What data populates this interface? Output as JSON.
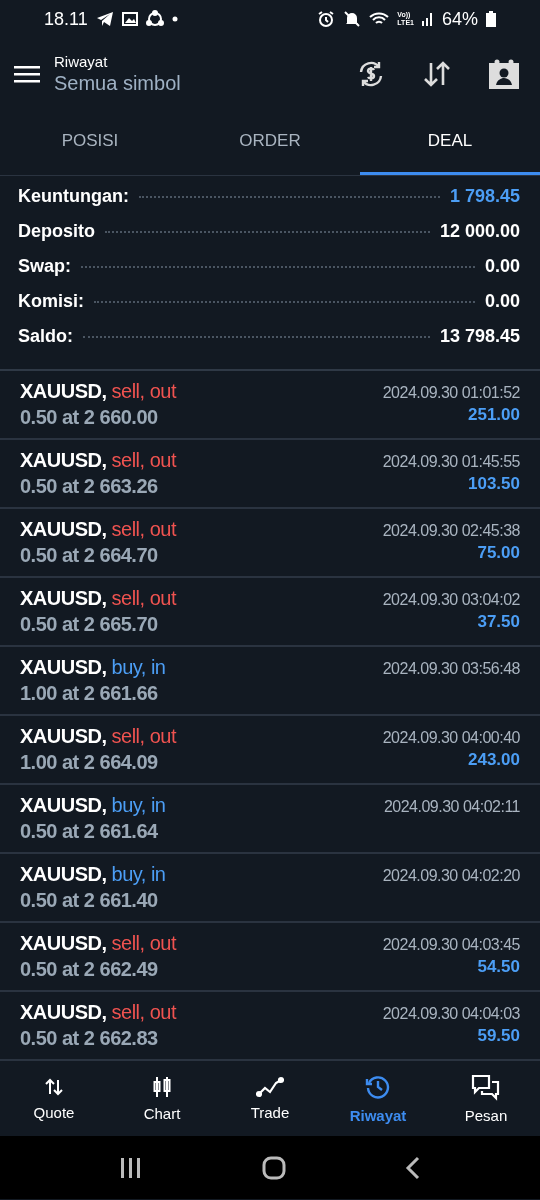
{
  "status_bar": {
    "time": "18.11",
    "network_top": "Vo))",
    "network_bottom": "LTE1",
    "battery": "64%"
  },
  "header": {
    "title": "Riwayat",
    "subtitle": "Semua simbol"
  },
  "tabs": [
    {
      "label": "POSISI",
      "selected": false
    },
    {
      "label": "ORDER",
      "selected": false
    },
    {
      "label": "DEAL",
      "selected": true
    }
  ],
  "summary": [
    {
      "label": "Keuntungan:",
      "value": "1 798.45",
      "kind": "profit"
    },
    {
      "label": "Deposito",
      "value": "12 000.00",
      "kind": "plain"
    },
    {
      "label": "Swap:",
      "value": "0.00",
      "kind": "plain"
    },
    {
      "label": "Komisi:",
      "value": "0.00",
      "kind": "plain"
    },
    {
      "label": "Saldo:",
      "value": "13 798.45",
      "kind": "plain"
    }
  ],
  "deals": [
    {
      "symbol": "XAUUSD,",
      "side": "sell, out",
      "kind": "sell",
      "volume_price": "0.50 at 2 660.00",
      "time": "2024.09.30 01:01:52",
      "profit": "251.00"
    },
    {
      "symbol": "XAUUSD,",
      "side": "sell, out",
      "kind": "sell",
      "volume_price": "0.50 at 2 663.26",
      "time": "2024.09.30 01:45:55",
      "profit": "103.50"
    },
    {
      "symbol": "XAUUSD,",
      "side": "sell, out",
      "kind": "sell",
      "volume_price": "0.50 at 2 664.70",
      "time": "2024.09.30 02:45:38",
      "profit": "75.00"
    },
    {
      "symbol": "XAUUSD,",
      "side": "sell, out",
      "kind": "sell",
      "volume_price": "0.50 at 2 665.70",
      "time": "2024.09.30 03:04:02",
      "profit": "37.50"
    },
    {
      "symbol": "XAUUSD,",
      "side": "buy, in",
      "kind": "buy",
      "volume_price": "1.00 at 2 661.66",
      "time": "2024.09.30 03:56:48"
    },
    {
      "symbol": "XAUUSD,",
      "side": "sell, out",
      "kind": "sell",
      "volume_price": "1.00 at 2 664.09",
      "time": "2024.09.30 04:00:40",
      "profit": "243.00"
    },
    {
      "symbol": "XAUUSD,",
      "side": "buy, in",
      "kind": "buy",
      "volume_price": "0.50 at 2 661.64",
      "time": "2024.09.30 04:02:11"
    },
    {
      "symbol": "XAUUSD,",
      "side": "buy, in",
      "kind": "buy",
      "volume_price": "0.50 at 2 661.40",
      "time": "2024.09.30 04:02:20"
    },
    {
      "symbol": "XAUUSD,",
      "side": "sell, out",
      "kind": "sell",
      "volume_price": "0.50 at 2 662.49",
      "time": "2024.09.30 04:03:45",
      "profit": "54.50"
    },
    {
      "symbol": "XAUUSD,",
      "side": "sell, out",
      "kind": "sell",
      "volume_price": "0.50 at 2 662.83",
      "time": "2024.09.30 04:04:03",
      "profit": "59.50"
    }
  ],
  "bottom_nav": [
    {
      "label": "Quote",
      "kind": "quote",
      "selected": false
    },
    {
      "label": "Chart",
      "kind": "chart",
      "selected": false
    },
    {
      "label": "Trade",
      "kind": "trade",
      "selected": false
    },
    {
      "label": "Riwayat",
      "kind": "history",
      "selected": true
    },
    {
      "label": "Pesan",
      "kind": "chat",
      "selected": false
    }
  ]
}
